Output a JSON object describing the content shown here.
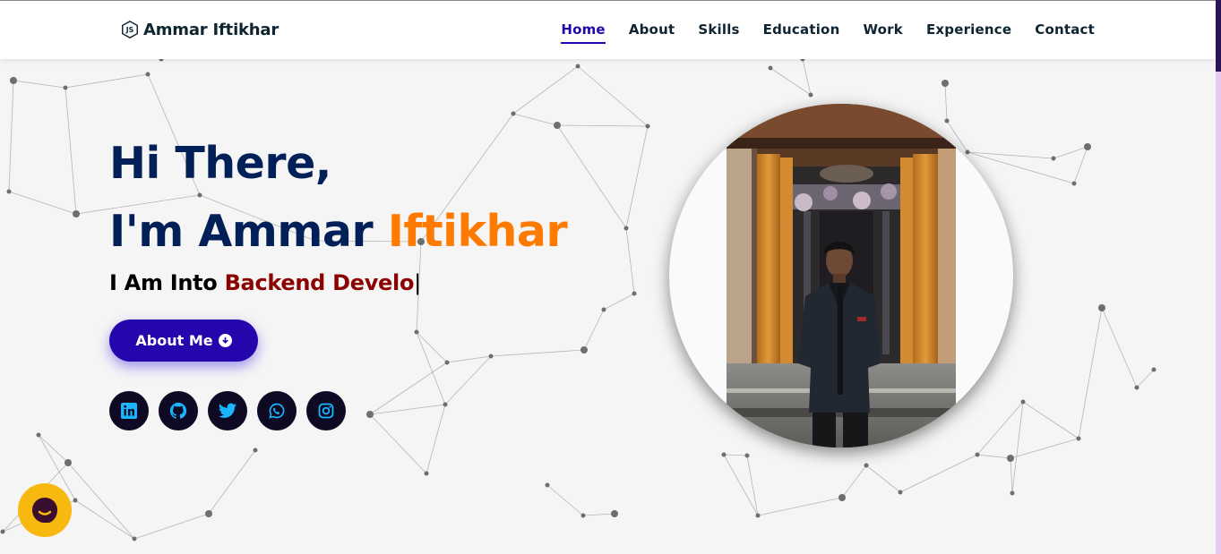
{
  "nav": {
    "brand": "Ammar Iftikhar",
    "brand_icon": "nodejs-icon",
    "links": [
      {
        "label": "Home",
        "active": true
      },
      {
        "label": "About",
        "active": false
      },
      {
        "label": "Skills",
        "active": false
      },
      {
        "label": "Education",
        "active": false
      },
      {
        "label": "Work",
        "active": false
      },
      {
        "label": "Experience",
        "active": false
      },
      {
        "label": "Contact",
        "active": false
      }
    ]
  },
  "hero": {
    "greeting": "Hi There,",
    "intro": "I'm Ammar ",
    "name_accent": "Iftikhar",
    "typing_prefix": "I Am Into ",
    "typing_text": "Backend Develo",
    "typing_cursor": "|",
    "button_label": "About Me",
    "button_icon": "arrow-circle-down-icon"
  },
  "socials": [
    {
      "name": "linkedin-icon"
    },
    {
      "name": "github-icon"
    },
    {
      "name": "twitter-icon"
    },
    {
      "name": "whatsapp-icon"
    },
    {
      "name": "instagram-icon"
    }
  ],
  "photo": {
    "subject": "profile-photo"
  },
  "chat": {
    "icon": "chat-bot-icon"
  },
  "colors": {
    "primary": "#2506ad",
    "heading": "#002057",
    "accent": "#ff7a00",
    "typed": "#8b0000",
    "social_bg": "#0e0a24",
    "social_icon": "#19b5fe",
    "chat": "#f7b80f",
    "background": "#f5f5f5"
  }
}
